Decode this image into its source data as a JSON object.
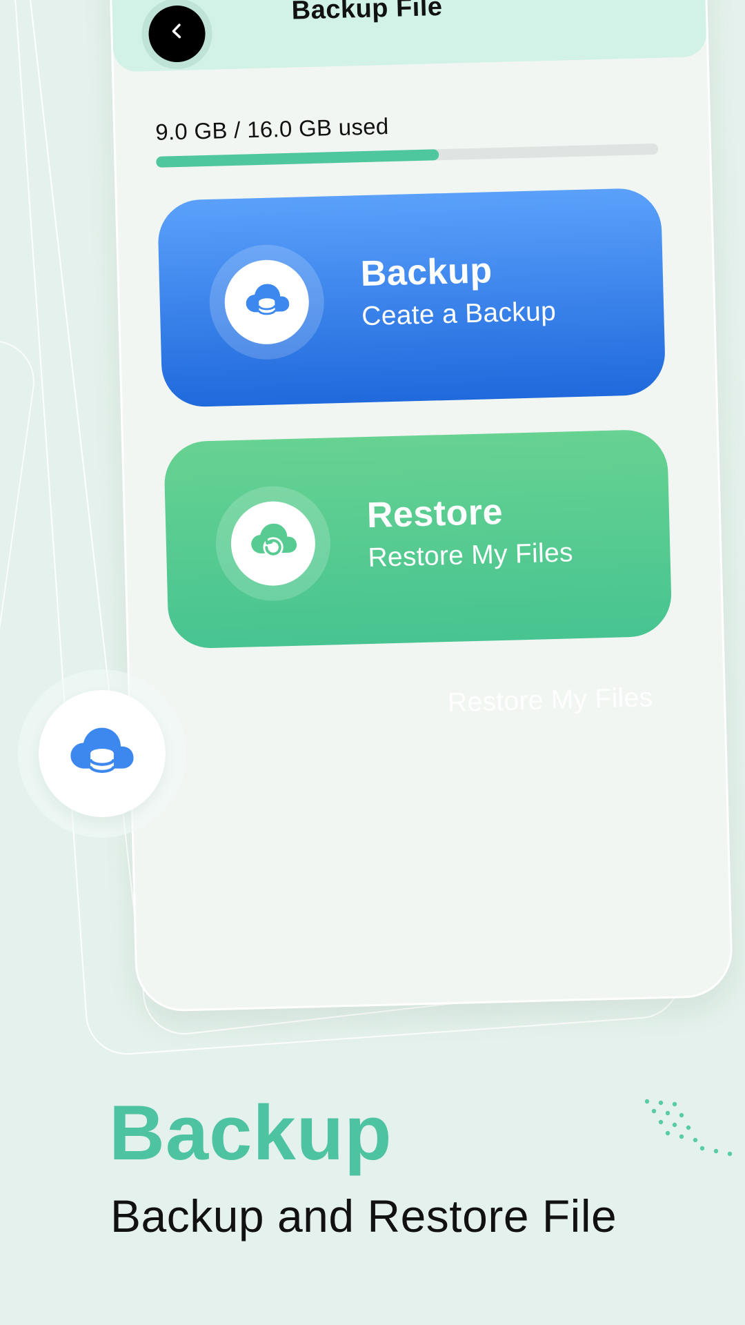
{
  "app": {
    "title": "Backup File"
  },
  "storage": {
    "text": "9.0 GB / 16.0 GB used",
    "used_gb": 9.0,
    "total_gb": 16.0,
    "percent": 56.25
  },
  "cards": {
    "backup": {
      "title": "Backup",
      "subtitle": "Ceate a Backup"
    },
    "restore": {
      "title": "Restore",
      "subtitle": "Restore My Files"
    },
    "ghost_label": "Restore My Files"
  },
  "promo": {
    "title": "Backup",
    "subtitle": "Backup and Restore File"
  },
  "colors": {
    "background": "#e5f1ec",
    "header": "#d2f1e7",
    "accent": "#4ec3a1",
    "backup_top": "#5ba1fb",
    "backup_bottom": "#1f69dc",
    "restore_top": "#67d291",
    "restore_bottom": "#47c491"
  },
  "icons": {
    "back": "chevron-left-icon",
    "backup": "cloud-database-icon",
    "restore": "cloud-restore-icon",
    "floating": "cloud-database-icon"
  }
}
